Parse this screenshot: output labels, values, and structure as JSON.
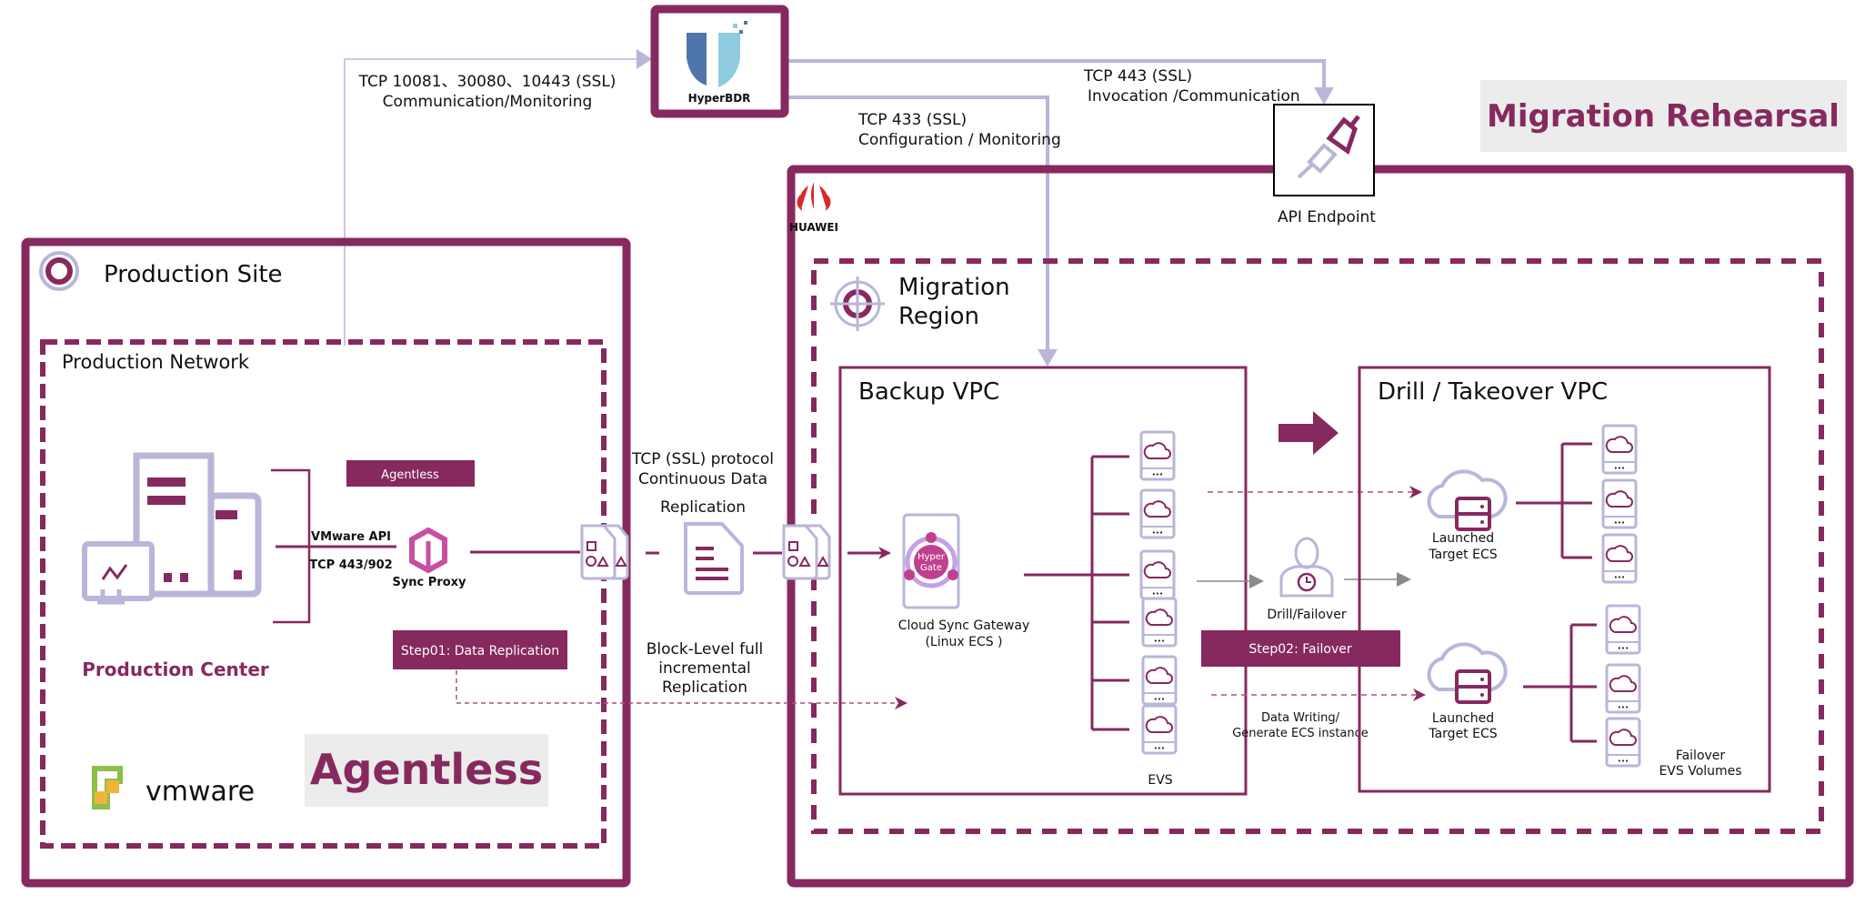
{
  "colors": {
    "brand": "#86295f",
    "accent": "#b8b6d9",
    "gray_box": "#ececec",
    "arrow_gray": "#8a8a8a"
  },
  "hyperbdr": {
    "label": "HyperBDR",
    "icon": "shield-icon"
  },
  "connections": {
    "prod_to_hyperbdr": [
      "TCP 10081、30080、10443 (SSL)",
      "Communication/Monitoring"
    ],
    "hyperbdr_to_api": [
      "TCP 443 (SSL)",
      "Invocation /Communication"
    ],
    "hyperbdr_to_backup": [
      "TCP 433 (SSL)",
      "Configuration / Monitoring"
    ]
  },
  "api_endpoint": {
    "label": "API Endpoint",
    "icon": "plug-icon"
  },
  "migration_rehearsal": "Migration Rehearsal",
  "production_site": {
    "title": "Production Site",
    "network_title": "Production Network",
    "agentless_tag": "Agentless",
    "vmware_api": "VMware API",
    "tcp_port": "TCP  443/902",
    "sync_proxy": "Sync Proxy",
    "production_center": "Production Center",
    "step01": "Step01: Data Replication",
    "agentless_big": "Agentless",
    "vmware_logo": "vmware"
  },
  "replication": {
    "continuous": [
      "TCP (SSL) protocol",
      "Continuous Data",
      "Replication"
    ],
    "block_level": [
      "Block-Level full",
      "incremental",
      "Replication"
    ]
  },
  "huawei": {
    "logo": "HUAWEI"
  },
  "migration_region": {
    "title": [
      "Migration",
      "Region"
    ]
  },
  "backup_vpc": {
    "title": "Backup VPC",
    "gateway_logo": [
      "Hyper",
      "Gate"
    ],
    "gateway_label": [
      "Cloud Sync Gateway",
      "(Linux ECS )"
    ],
    "evs_label": "EVS"
  },
  "middle": {
    "drill_failover": "Drill/Failover",
    "step02": "Step02:  Failover",
    "data_writing": [
      "Data Writing/",
      "Generate ECS instance"
    ]
  },
  "drill_vpc": {
    "title": "Drill / Takeover VPC",
    "ecs_label": [
      "Launched",
      "Target ECS"
    ],
    "failover_label": [
      "Failover",
      "EVS Volumes"
    ]
  }
}
